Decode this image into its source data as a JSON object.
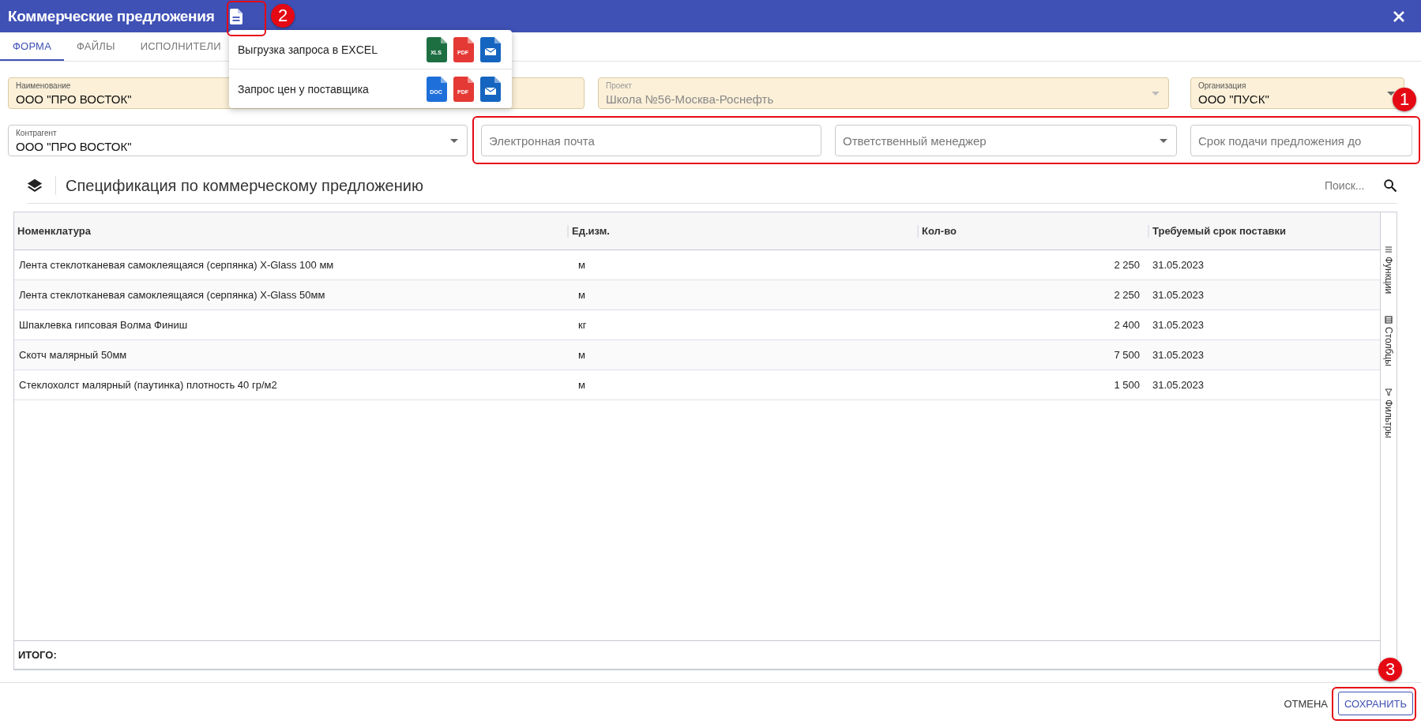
{
  "window": {
    "title": "Коммерческие предложения"
  },
  "tabs": [
    {
      "label": "ФОРМА",
      "selected": true
    },
    {
      "label": "ФАЙЛЫ",
      "selected": false
    },
    {
      "label": "ИСПОЛНИТЕЛИ",
      "selected": false
    }
  ],
  "export_menu": {
    "items": [
      {
        "label": "Выгрузка запроса в EXCEL",
        "formats": [
          {
            "kind": "xls",
            "label": "XLS"
          },
          {
            "kind": "pdf",
            "label": "PDF"
          },
          {
            "kind": "email"
          }
        ]
      },
      {
        "label": "Запрос цен у поставщика",
        "formats": [
          {
            "kind": "doc",
            "label": "DOC"
          },
          {
            "kind": "pdf",
            "label": "PDF"
          },
          {
            "kind": "email"
          }
        ]
      }
    ]
  },
  "field_rows": [
    {
      "fields": [
        {
          "kind": "text",
          "label": "Наименование",
          "value": "ООО \"ПРО ВОСТОК\"",
          "highlighted": true,
          "disabled": false
        },
        {
          "kind": "select",
          "label": "Проект",
          "value": "Школа №56-Москва-Роснефть",
          "highlighted": true,
          "disabled": true
        },
        {
          "kind": "select",
          "label": "Организация",
          "value": "ООО \"ПУСК\"",
          "highlighted": true,
          "disabled": false
        }
      ]
    },
    {
      "fields": [
        {
          "kind": "select",
          "label": "Контрагент",
          "value": "ООО \"ПРО ВОСТОК\"",
          "highlighted": false,
          "disabled": false
        },
        {
          "kind": "text",
          "placeholder": "Электронная почта",
          "highlighted": false,
          "disabled": false
        },
        {
          "kind": "select",
          "placeholder": "Ответственный менеджер",
          "highlighted": false,
          "disabled": false
        },
        {
          "kind": "text",
          "placeholder": "Срок подачи предложения до",
          "highlighted": false,
          "disabled": false
        }
      ]
    }
  ],
  "section": {
    "title": "Спецификация по коммерческому предложению",
    "search": {
      "placeholder": "Поиск..."
    }
  },
  "table": {
    "columns": [
      "Номенклатура",
      "Ед.изм.",
      "Кол-во",
      "Требуемый срок поставки"
    ],
    "rows": [
      [
        "Лента стеклотканевая самоклеящаяся (серпянка) X-Glass 100 мм",
        "м",
        "2 250",
        "31.05.2023"
      ],
      [
        "Лента стеклотканевая самоклеящаяся (серпянка) X-Glass 50мм",
        "м",
        "2 250",
        "31.05.2023"
      ],
      [
        "Шпаклевка гипсовая Волма Финиш",
        "кг",
        "2 400",
        "31.05.2023"
      ],
      [
        "Скотч малярный 50мм",
        "м",
        "7 500",
        "31.05.2023"
      ],
      [
        "Стеклохолст малярный (паутинка) плотность 40 гр/м2",
        "м",
        "1 500",
        "31.05.2023"
      ]
    ],
    "footer": "ИТОГО:",
    "side_tabs": [
      {
        "kind": "functions",
        "label": "Функции"
      },
      {
        "kind": "columns",
        "label": "Столбцы"
      },
      {
        "kind": "filters",
        "label": "Фильтры"
      }
    ]
  },
  "actions": [
    {
      "kind": "text",
      "label": "ОТМЕНА"
    },
    {
      "kind": "outlined",
      "label": "СОХРАНИТЬ"
    }
  ],
  "annotations": [
    {
      "number": "1"
    },
    {
      "number": "2"
    },
    {
      "number": "3"
    }
  ]
}
